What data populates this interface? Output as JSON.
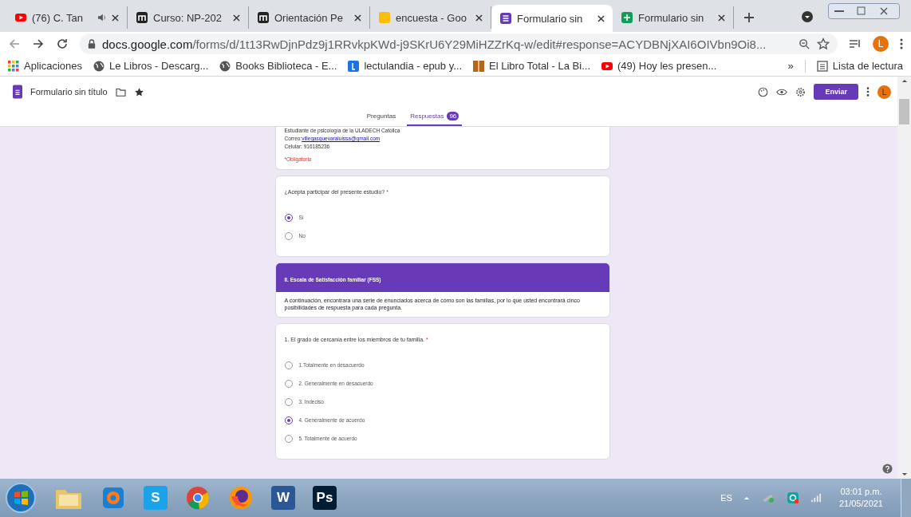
{
  "browser": {
    "tabs": [
      {
        "title": "(76) C. Tan",
        "kind": "youtube",
        "audio": true,
        "selected": false
      },
      {
        "title": "Curso: NP-202",
        "kind": "m",
        "audio": false,
        "selected": false
      },
      {
        "title": "Orientación Pe",
        "kind": "m",
        "audio": false,
        "selected": false
      },
      {
        "title": "encuesta - Goo",
        "kind": "drive",
        "audio": false,
        "selected": false
      },
      {
        "title": "Formulario sin",
        "kind": "forms",
        "audio": false,
        "selected": true
      },
      {
        "title": "Formulario sin",
        "kind": "sheets",
        "audio": false,
        "selected": false
      }
    ],
    "url_host": "docs.google.com",
    "url_path": "/forms/d/1t13RwDjnPdz9j1RRvkpKWd-j9SKrU6Y29MiHZZrKq-w/edit#response=ACYDBNjXAI6OIVbn9Oi8...",
    "profile_initial": "L",
    "bookmarks": [
      {
        "label": "Aplicaciones",
        "kind": "apps"
      },
      {
        "label": "Le Libros - Descarg...",
        "kind": "globe"
      },
      {
        "label": "Books Biblioteca - E...",
        "kind": "globe"
      },
      {
        "label": "lectulandia - epub y...",
        "kind": "letter"
      },
      {
        "label": "El Libro Total - La Bi...",
        "kind": "book"
      },
      {
        "label": "(49) Hoy les presen...",
        "kind": "youtube"
      }
    ],
    "more_bookmarks": "»",
    "reading_list": "Lista de lectura"
  },
  "form_header": {
    "title": "Formulario sin título",
    "send_button": "Enviar",
    "avatar_initial": "L",
    "tabs": [
      {
        "label": "Preguntas",
        "selected": false
      },
      {
        "label": "Respuestas",
        "badge": "96",
        "selected": true
      }
    ]
  },
  "cards": [
    {
      "kind": "intro",
      "lines": [
        "Estudiante de psicología de la ULADECH Católica"
      ],
      "email_label": "Correo: ",
      "email": "villegasguevaraluissa@gmail.com",
      "phone": "Celular: 916185236",
      "required_note": "*Obligatorio"
    },
    {
      "kind": "question",
      "question": "¿Acepta participar del presente estudio?",
      "required_mark": "*",
      "options": [
        {
          "label": "Sí",
          "selected": true
        },
        {
          "label": "No",
          "selected": false
        }
      ]
    },
    {
      "kind": "section",
      "title": "II. Escala de Satisfacción familiar (FSS)",
      "description": "A continuación, encontrara una serie de enunciados acerca de cómo son las familias, por lo que usted encontrará cinco posibilidades de respuesta para cada pregunta."
    },
    {
      "kind": "question",
      "question": "1. El grado de cercanía entre los miembros de tu familia.",
      "required_mark": "*",
      "options": [
        {
          "label": "1.Totalmente en desacuerdo",
          "selected": false
        },
        {
          "label": "2. Generalmente en desacuerdo",
          "selected": false
        },
        {
          "label": "3. Indeciso",
          "selected": false
        },
        {
          "label": "4. Generalmente de acuerdo",
          "selected": true
        },
        {
          "label": "5. Totalmente de acuerdo",
          "selected": false
        }
      ]
    }
  ],
  "taskbar": {
    "apps": [
      {
        "kind": "start"
      },
      {
        "kind": "folder"
      },
      {
        "kind": "player"
      },
      {
        "kind": "skype",
        "label": "S"
      },
      {
        "kind": "chrome"
      },
      {
        "kind": "firefox"
      },
      {
        "kind": "word",
        "label": "W"
      },
      {
        "kind": "photoshop",
        "label": "Ps"
      }
    ],
    "language": "ES",
    "time": "03:01 p.m.",
    "date": "21/05/2021"
  }
}
